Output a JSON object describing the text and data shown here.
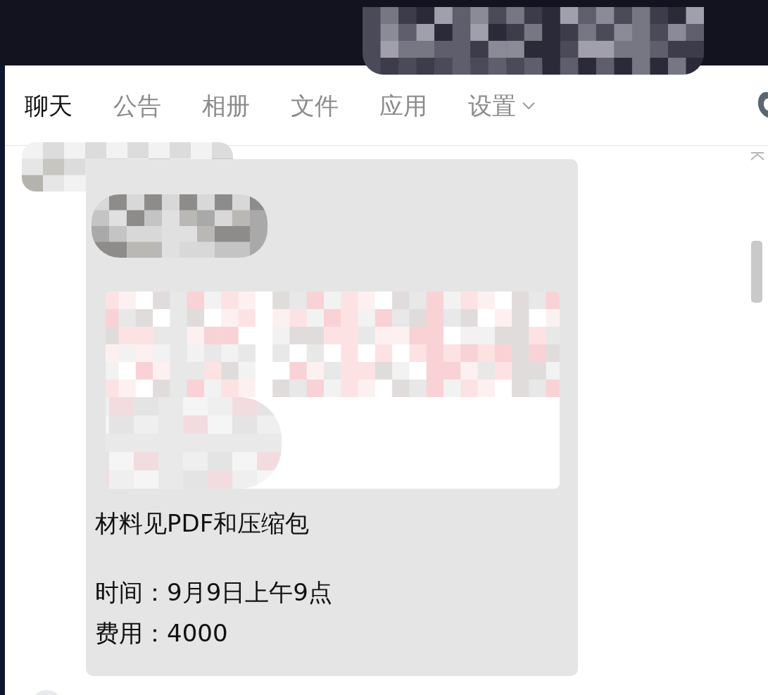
{
  "tabs": [
    {
      "label": "聊天",
      "selected": true,
      "has_menu": false
    },
    {
      "label": "公告",
      "selected": false,
      "has_menu": false
    },
    {
      "label": "相册",
      "selected": false,
      "has_menu": false
    },
    {
      "label": "文件",
      "selected": false,
      "has_menu": false
    },
    {
      "label": "应用",
      "selected": false,
      "has_menu": false
    },
    {
      "label": "设置",
      "selected": false,
      "has_menu": true
    }
  ],
  "message": {
    "paragraphs": [
      [
        "材料见PDF和压缩包"
      ],
      [
        "时间：9月9日上午9点",
        "费用：4000"
      ]
    ]
  }
}
